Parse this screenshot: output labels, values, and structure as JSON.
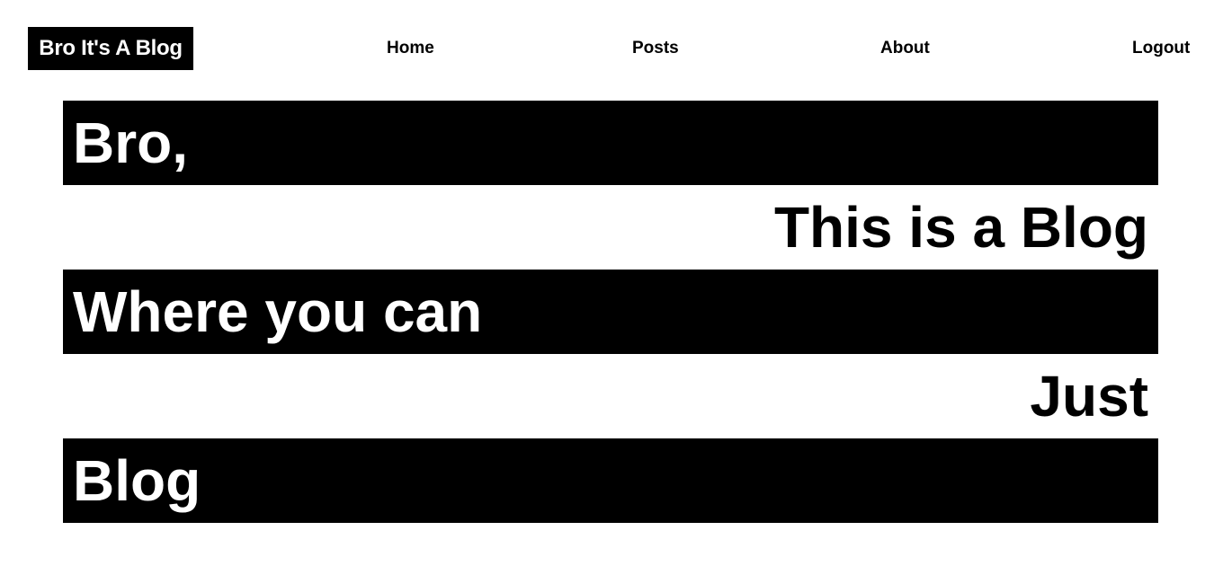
{
  "brand": {
    "title": "Bro It's A Blog"
  },
  "nav": {
    "home": "Home",
    "posts": "Posts",
    "about": "About",
    "logout": "Logout"
  },
  "hero": {
    "lines": [
      "Bro,",
      "This is a Blog",
      "Where you can",
      "Just",
      "Blog"
    ]
  },
  "colors": {
    "background": "#ffffff",
    "band": "#000000",
    "band_text": "#ffffff",
    "text": "#000000"
  }
}
